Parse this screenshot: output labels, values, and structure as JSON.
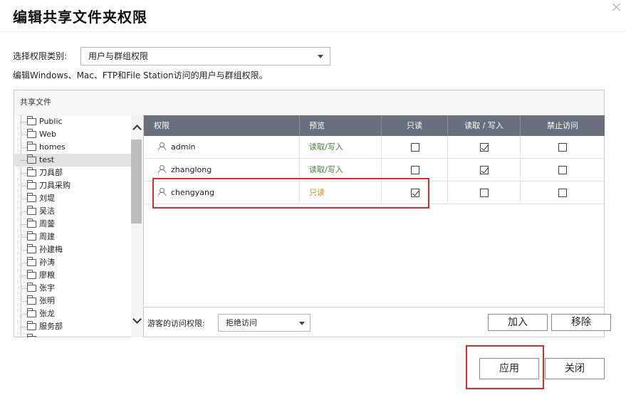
{
  "dialog": {
    "title": "编辑共享文件夹权限",
    "close_icon": "close-icon"
  },
  "permission_type": {
    "label": "选择权限类别:",
    "selected": "用户与群组权限",
    "description": "编辑Windows、Mac、FTP和File Station访问的用户与群组权限。"
  },
  "panel": {
    "header": "共享文件"
  },
  "tree": {
    "items": [
      {
        "label": "Public",
        "selected": false
      },
      {
        "label": "Web",
        "selected": false
      },
      {
        "label": "homes",
        "selected": false
      },
      {
        "label": "test",
        "selected": true
      },
      {
        "label": "刀具部",
        "selected": false
      },
      {
        "label": "刀具采购",
        "selected": false
      },
      {
        "label": "刘堤",
        "selected": false
      },
      {
        "label": "吴洁",
        "selected": false
      },
      {
        "label": "周蓥",
        "selected": false
      },
      {
        "label": "周建",
        "selected": false
      },
      {
        "label": "孙建梅",
        "selected": false
      },
      {
        "label": "孙涛",
        "selected": false
      },
      {
        "label": "廖粮",
        "selected": false
      },
      {
        "label": "张宇",
        "selected": false
      },
      {
        "label": "张明",
        "selected": false
      },
      {
        "label": "张龙",
        "selected": false
      },
      {
        "label": "服务部",
        "selected": false
      },
      {
        "label": "…",
        "selected": false
      }
    ]
  },
  "grid": {
    "headers": [
      "权限",
      "预览",
      "只读",
      "读取 / 写入",
      "禁止访问"
    ],
    "rows": [
      {
        "user": "admin",
        "preview": "读取/写入",
        "preview_color": "#3a8a2a",
        "read_only": false,
        "read_write": true,
        "deny": false
      },
      {
        "user": "zhanglong",
        "preview": "读取/写入",
        "preview_color": "#3a8a2a",
        "read_only": false,
        "read_write": true,
        "deny": false
      },
      {
        "user": "chengyang",
        "preview": "只读",
        "preview_color": "#e08a00",
        "read_only": true,
        "read_write": false,
        "deny": false
      }
    ]
  },
  "footer": {
    "guest_label": "游客的访问权限:",
    "guest_selected": "拒绝访问",
    "add_label": "加入",
    "remove_label": "移除"
  },
  "actions": {
    "apply_label": "应用",
    "close_label": "关闭"
  }
}
